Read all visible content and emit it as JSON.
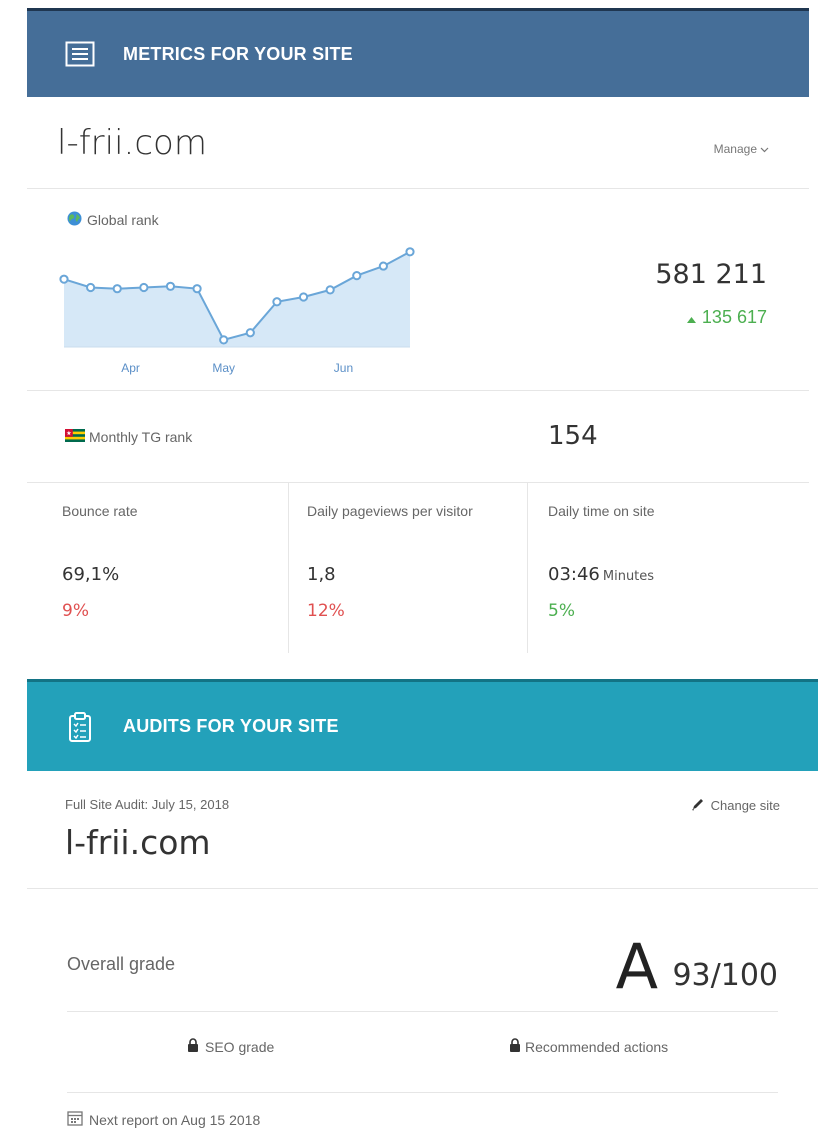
{
  "metrics": {
    "header_title": "METRICS FOR YOUR SITE",
    "header_icon": "newspaper-icon",
    "site_name": "l-frii.com",
    "manage_label": "Manage",
    "global_rank": {
      "label": "Global rank",
      "value": "581 211",
      "change": "135 617",
      "change_direction": "up"
    },
    "monthly_tg_rank": {
      "label": "Monthly TG rank",
      "value": "154"
    },
    "stats": [
      {
        "label": "Bounce rate",
        "value": "69,1%",
        "unit": "",
        "change": "9%",
        "trend": "bad"
      },
      {
        "label": "Daily pageviews per visitor",
        "value": "1,8",
        "unit": "",
        "change": "12%",
        "trend": "bad"
      },
      {
        "label": "Daily time on site",
        "value": "03:46",
        "unit": "Minutes",
        "change": "5%",
        "trend": "good"
      }
    ]
  },
  "chart_data": {
    "type": "area",
    "title": "",
    "x_tick_labels": [
      "Apr",
      "May",
      "Jun"
    ],
    "x_tick_index": [
      2.5,
      6.0,
      10.5
    ],
    "values": [
      0.57,
      0.5,
      0.49,
      0.5,
      0.51,
      0.49,
      0.06,
      0.12,
      0.38,
      0.42,
      0.48,
      0.6,
      0.68,
      0.8
    ],
    "ylabel": "",
    "y_axis_labels_shown": false,
    "grid": false,
    "colors": {
      "line": "#6aa6d8",
      "fill": "#d6e8f7",
      "point_fill": "#ffffff"
    }
  },
  "audits": {
    "header_title": "AUDITS FOR YOUR SITE",
    "header_icon": "clipboard-icon",
    "audit_date": "Full Site Audit: July 15, 2018",
    "change_site_label": "Change site",
    "site_name": "l-frii.com",
    "overall_grade_label": "Overall grade",
    "grade_letter": "A",
    "grade_score": "93/100",
    "seo_grade_label": "SEO grade",
    "recommended_actions_label": "Recommended actions",
    "next_report": "Next report on Aug 15 2018"
  },
  "colors": {
    "metrics_header": "#456e98",
    "audits_header": "#23a1ba",
    "positive": "#4caf50",
    "negative": "#e05050"
  }
}
